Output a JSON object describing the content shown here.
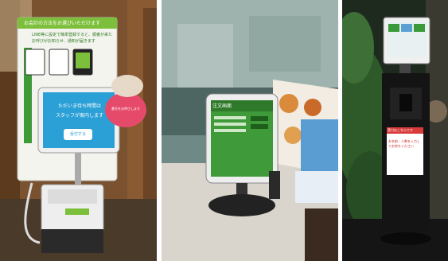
{
  "photos": [
    {
      "sign_title": "お会計の方法をお選びいただけます",
      "sign_text_1": "LINE等に設定で簡単登録すると、順番が来たら",
      "sign_text_2": "お呼びがお知らせ、通知が届きます",
      "screen_text_1": "ただいま待ち時間は",
      "screen_text_2": "スタッフが案内します",
      "screen_button": "受付する",
      "bubble_text": "番号をお呼びします"
    },
    {
      "tablet_label": "注文画面"
    },
    {
      "poster_title": "受付はこちらです",
      "poster_text": "お名前・人数を入力してお待ちください"
    }
  ]
}
